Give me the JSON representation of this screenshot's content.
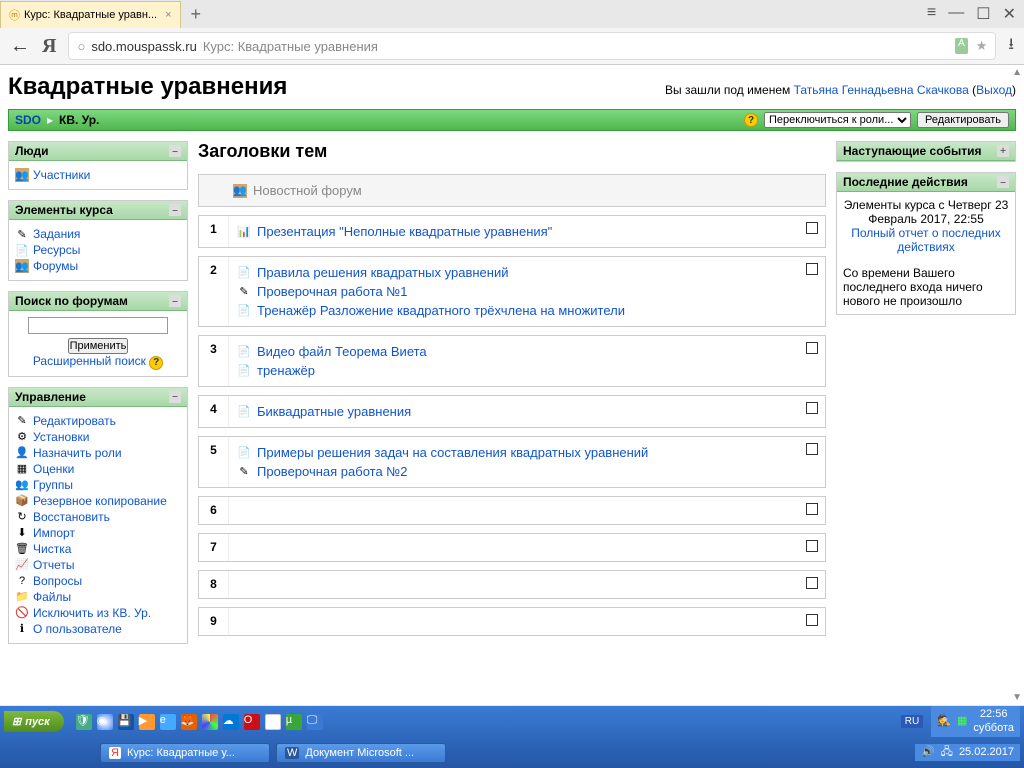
{
  "browser": {
    "tab_title": "Курс: Квадратные уравн...",
    "domain": "sdo.mouspassk.ru",
    "page_title": "Курс: Квадратные уравнения"
  },
  "page": {
    "title": "Квадратные уравнения",
    "login_prefix": "Вы зашли под именем ",
    "user_name": "Татьяна Геннадьевна Скачкова",
    "logout": "Выход"
  },
  "navbar": {
    "home": "SDO",
    "current": "КВ. Ур.",
    "role_switch": "Переключиться к роли...",
    "edit": "Редактировать"
  },
  "blocks": {
    "people": {
      "title": "Люди",
      "items": [
        "Участники"
      ]
    },
    "activities": {
      "title": "Элементы курса",
      "items": [
        "Задания",
        "Ресурсы",
        "Форумы"
      ]
    },
    "search": {
      "title": "Поиск по форумам",
      "submit": "Применить",
      "advanced": "Расширенный поиск"
    },
    "admin": {
      "title": "Управление",
      "items": [
        "Редактировать",
        "Установки",
        "Назначить роли",
        "Оценки",
        "Группы",
        "Резервное копирование",
        "Восстановить",
        "Импорт",
        "Чистка",
        "Отчеты",
        "Вопросы",
        "Файлы",
        "Исключить из КВ. Ур.",
        "О пользователе"
      ]
    },
    "upcoming": {
      "title": "Наступающие события"
    },
    "recent": {
      "title": "Последние действия",
      "since": "Элементы курса с Четверг 23 Февраль 2017, 22:55",
      "report": "Полный отчет о последних действиях",
      "nothing": "Со времени Вашего последнего входа ничего нового не произошло"
    }
  },
  "topics": {
    "heading": "Заголовки тем",
    "news": "Новостной форум",
    "sections": [
      {
        "num": "1",
        "items": [
          {
            "t": "Презентация \"Неполные квадратные уравнения\"",
            "icon": "ppt"
          }
        ]
      },
      {
        "num": "2",
        "items": [
          {
            "t": "Правила решения квадратных уравнений",
            "icon": "doc"
          },
          {
            "t": "Проверочная работа №1",
            "icon": "quiz"
          },
          {
            "t": "Тренажёр Разложение квадратного трёхчлена на множители",
            "icon": "doc"
          }
        ]
      },
      {
        "num": "3",
        "items": [
          {
            "t": "Видео файл Теорема Виета",
            "icon": "doc"
          },
          {
            "t": "тренажёр",
            "icon": "doc"
          }
        ]
      },
      {
        "num": "4",
        "items": [
          {
            "t": "Биквадратные уравнения",
            "icon": "doc"
          }
        ]
      },
      {
        "num": "5",
        "items": [
          {
            "t": "Примеры решения задач на составления квадратных уравнений",
            "icon": "doc"
          },
          {
            "t": "Проверочная работа №2",
            "icon": "quiz"
          }
        ]
      },
      {
        "num": "6",
        "items": []
      },
      {
        "num": "7",
        "items": []
      },
      {
        "num": "8",
        "items": []
      },
      {
        "num": "9",
        "items": []
      }
    ]
  },
  "taskbar": {
    "start": "пуск",
    "task1": "Курс: Квадратные у...",
    "task2": "Документ Microsoft ...",
    "lang": "RU",
    "time": "22:56",
    "day": "суббота",
    "date": "25.02.2017"
  }
}
